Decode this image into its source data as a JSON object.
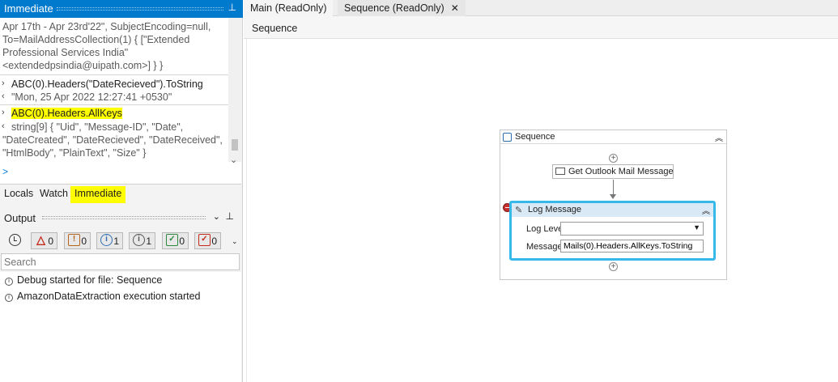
{
  "immediate": {
    "title": "Immediate",
    "lines_out1": [
      "Apr 17th - Apr 23rd'22\", SubjectEncoding=null,",
      "To=MailAddressCollection(1) { [\"Extended",
      "Professional Services India\"",
      "<extendedpsindia@uipath.com>] } }"
    ],
    "cmd1": "ABC(0).Headers(\"DateRecieved\").ToString",
    "result1": "\"Mon, 25 Apr 2022 12:27:41 +0530\"",
    "cmd2": "ABC(0).Headers.AllKeys",
    "result2_lines": [
      "string[9] { \"Uid\", \"Message-ID\", \"Date\",",
      "\"DateCreated\", \"DateRecieved\", \"DateReceived\",",
      "\"HtmlBody\", \"PlainText\", \"Size\" }"
    ],
    "prompt": ">",
    "highlight_color": "#ffff00"
  },
  "bottom_tabs": [
    "Locals",
    "Watch",
    "Immediate"
  ],
  "output": {
    "title": "Output",
    "filters": {
      "errors": "0",
      "warnings": "0",
      "info": "1",
      "trace": "1",
      "success": "0",
      "failed": "0"
    },
    "search_placeholder": "Search",
    "items": [
      "Debug started for file: Sequence",
      "AmazonDataExtraction execution started"
    ]
  },
  "doc_tabs": {
    "main": "Main (ReadOnly)",
    "sequence": "Sequence (ReadOnly)"
  },
  "breadcrumb": "Sequence",
  "designer": {
    "sequence_title": "Sequence",
    "outlook_activity": "Get Outlook Mail Message",
    "log_activity": "Log Message",
    "log_level_label": "Log Level",
    "log_level_value": "",
    "message_label": "Message",
    "message_value": "Mails(0).Headers.AllKeys.ToString",
    "accent_color": "#36b8e8"
  }
}
